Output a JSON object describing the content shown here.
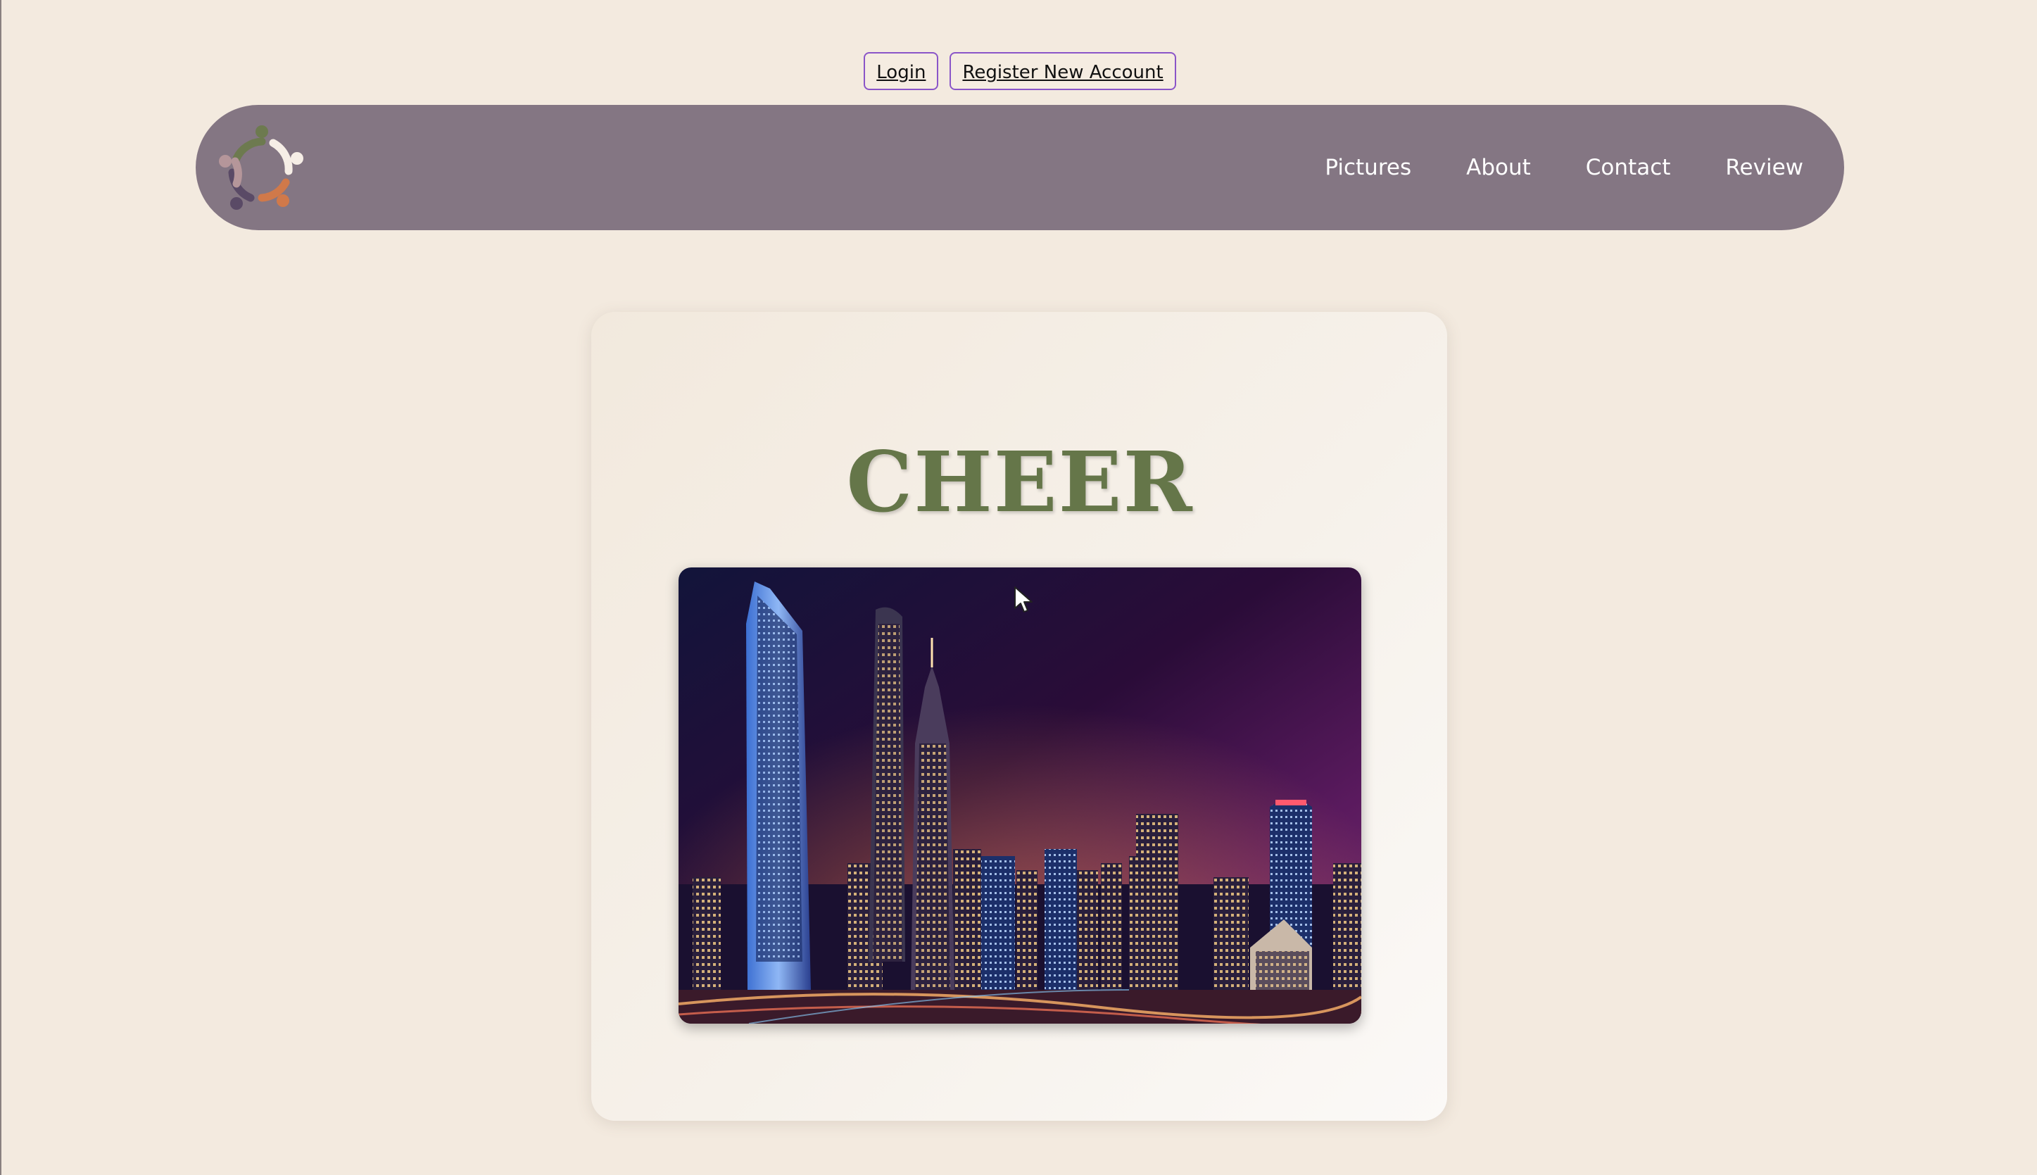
{
  "auth": {
    "login_label": "Login",
    "register_label": "Register New Account"
  },
  "navbar": {
    "logo_icon": "people-circle-logo",
    "links": [
      "Pictures",
      "About",
      "Contact",
      "Review"
    ]
  },
  "hero": {
    "title": "CHEER",
    "image_icon": "city-skyline-night-photo"
  },
  "colors": {
    "background": "#f3eadf",
    "navbar": "#847683",
    "title": "#657649",
    "button_border": "#8a55c8"
  }
}
